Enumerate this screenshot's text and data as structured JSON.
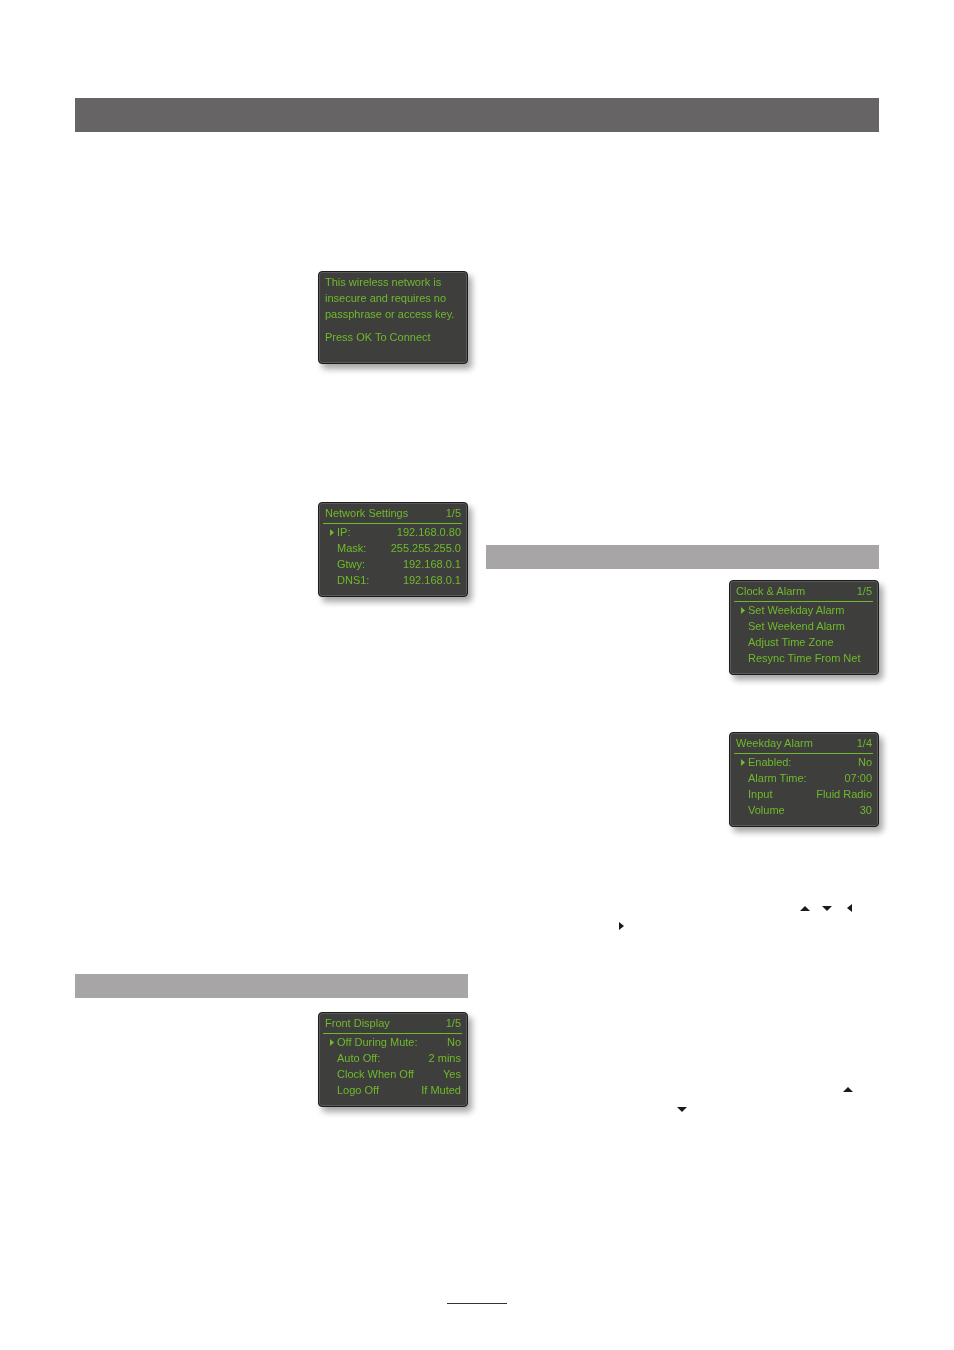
{
  "screens": [
    {
      "kind": "message",
      "message_lines": [
        "This wireless network is",
        "insecure and requires no",
        "passphrase or access key."
      ],
      "prompt": "Press OK To Connect"
    },
    {
      "kind": "menu",
      "title": "Network Settings",
      "page": "1/5",
      "rows": [
        {
          "label": "IP:",
          "value": "192.168.0.80",
          "selected": true
        },
        {
          "label": "Mask:",
          "value": "255.255.255.0",
          "selected": false
        },
        {
          "label": "Gtwy:",
          "value": "192.168.0.1",
          "selected": false
        },
        {
          "label": "DNS1:",
          "value": "192.168.0.1",
          "selected": false
        }
      ]
    },
    {
      "kind": "menu",
      "title": "Front Display",
      "page": "1/5",
      "rows": [
        {
          "label": "Off During Mute:",
          "value": "No",
          "selected": true
        },
        {
          "label": "Auto Off:",
          "value": "2 mins",
          "selected": false
        },
        {
          "label": "Clock When Off",
          "value": "Yes",
          "selected": false
        },
        {
          "label": "Logo Off",
          "value": "If Muted",
          "selected": false
        }
      ]
    },
    {
      "kind": "menu",
      "title": "Clock & Alarm",
      "page": "1/5",
      "rows": [
        {
          "label": "Set Weekday Alarm",
          "selected": true
        },
        {
          "label": "Set Weekend Alarm",
          "selected": false
        },
        {
          "label": "Adjust Time Zone",
          "selected": false
        },
        {
          "label": "Resync Time From Net",
          "selected": false
        }
      ]
    },
    {
      "kind": "menu",
      "title": "Weekday Alarm",
      "page": "1/4",
      "rows": [
        {
          "label": "Enabled:",
          "value": "No",
          "selected": true
        },
        {
          "label": "Alarm Time:",
          "value": "07:00",
          "selected": false
        },
        {
          "label": "Input",
          "value": "Fluid Radio",
          "selected": false
        },
        {
          "label": "Volume",
          "value": "30",
          "selected": false
        }
      ]
    }
  ]
}
